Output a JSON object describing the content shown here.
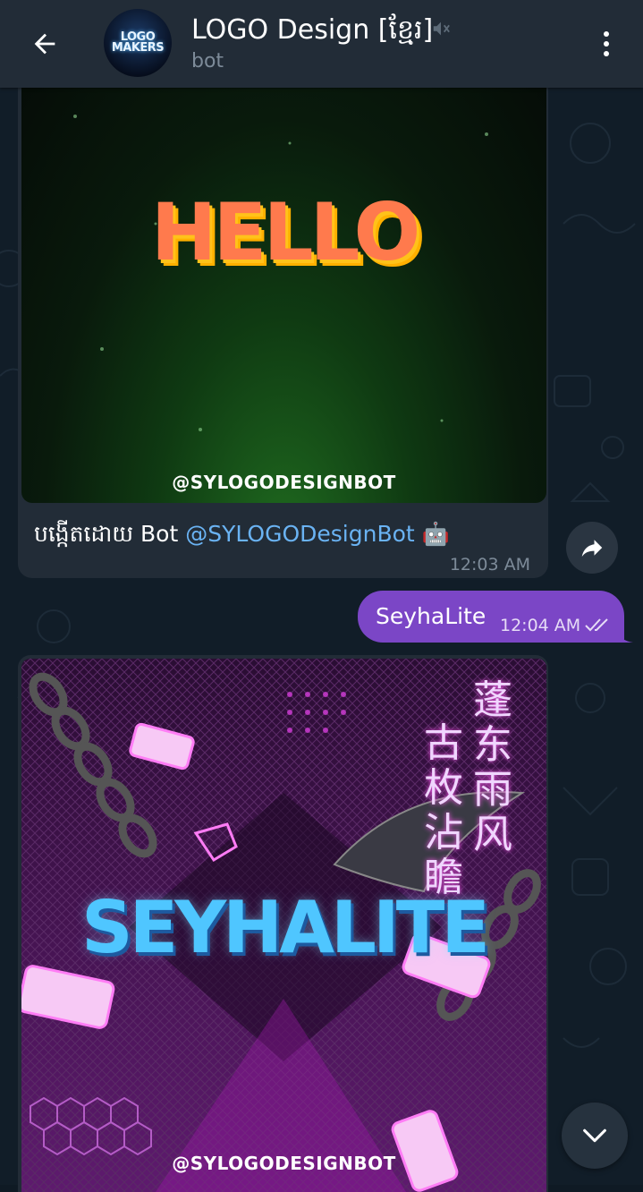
{
  "header": {
    "title": "LOGO Design [ខ្មែរ]",
    "subtitle": "bot",
    "avatar_text_line1": "LOGO",
    "avatar_text_line2": "MAKERS"
  },
  "messages": [
    {
      "direction": "incoming",
      "image_text": "HELLO",
      "image_watermark": "@SYLOGODESIGNBOT",
      "caption_prefix": "បង្កើតដោយ Bot ",
      "caption_link": "@SYLOGODesignBot",
      "caption_emoji": "🤖",
      "time": "12:03 AM"
    },
    {
      "direction": "outgoing",
      "text": "SeyhaLite",
      "time": "12:04 AM",
      "status": "read"
    },
    {
      "direction": "incoming",
      "image_text": "SEYHALITE",
      "image_watermark": "@SYLOGODESIGNBOT",
      "image_cjk_col1": "蓬东雨风",
      "image_cjk_col2": "古枚沾瞻"
    }
  ],
  "colors": {
    "header_bg": "#222c37",
    "incoming_bubble": "#222c37",
    "outgoing_bubble": "#7b46c6",
    "link": "#6ab3f3",
    "muted_text": "#7d8b99"
  },
  "icons": [
    "back-arrow-icon",
    "mute-icon",
    "more-vert-icon",
    "forward-icon",
    "double-check-icon",
    "scroll-down-icon"
  ]
}
